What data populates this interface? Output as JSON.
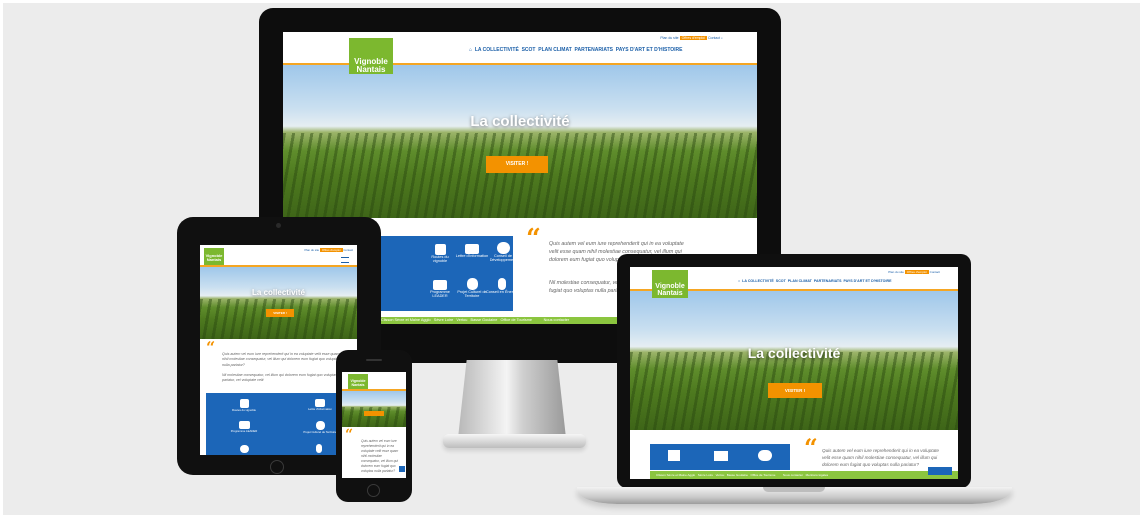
{
  "site": {
    "logo_line1": "Vignoble",
    "logo_line2": "Nantais",
    "nav": [
      "LA COLLECTIVITÉ",
      "SCOT",
      "PLAN CLIMAT",
      "PARTENARIATS",
      "PAYS D'ART ET D'HISTOIRE"
    ],
    "top_links": [
      "Plan du site",
      "Offres d'emploi",
      "Contact"
    ],
    "hero_title": "La collectivité",
    "hero_button": "VISITER !",
    "quote_text_1": "Quis autem vel eum iure reprehenderit qui in ea voluptate velit esse quam nihil molestiae consequatur, vel illum qui dolorem eum fugiat quo voluptas nulla pariatur?",
    "quote_text_2": "Nil molestiae consequatur, vel illum qui dolorem eum fugiat quo voluptas nulla pariatur, vel voluptate velit",
    "tiles": [
      {
        "label": "Routes du vignoble",
        "icon": "map-icon"
      },
      {
        "label": "Lettre d'information",
        "icon": "envelope-icon"
      },
      {
        "label": "Conseil de Développement",
        "icon": "people-icon"
      },
      {
        "label": "Programme LEADER",
        "icon": "eu-flag-icon"
      },
      {
        "label": "Projet Culturel de Territoire",
        "icon": "theatre-icon"
      },
      {
        "label": "Conseil en Énergie",
        "icon": "lightbulb-icon"
      }
    ],
    "footer_links": [
      "Clisson Sèvre et Maine Agglo",
      "Sèvre Loire",
      "Vertou",
      "Basse Goulaine",
      "Office de Tourisme",
      "Nous contacter",
      "Mentions légales"
    ]
  },
  "colors": {
    "brand_green": "#8bc53f",
    "brand_blue": "#1c66b8",
    "accent_orange": "#f39200",
    "background": "#ececec"
  }
}
